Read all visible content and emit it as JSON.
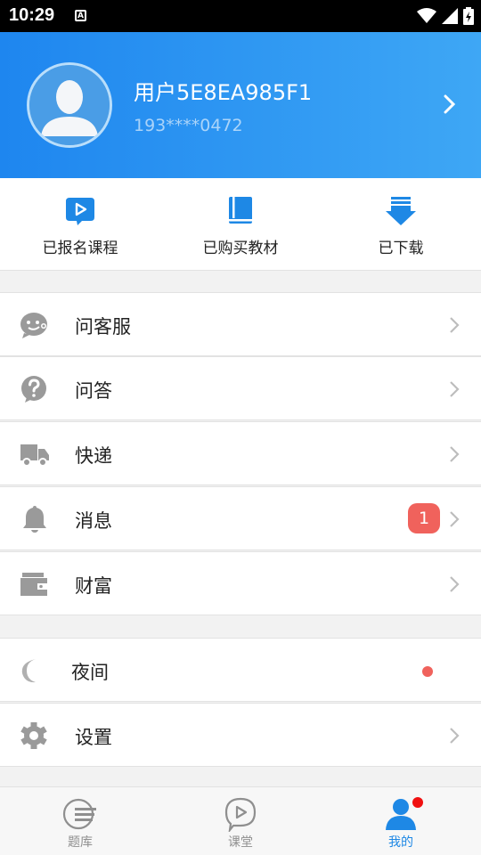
{
  "status_bar": {
    "time": "10:29",
    "a_badge": "A"
  },
  "profile": {
    "username": "用户5E8EA985F1",
    "phone": "193****0472"
  },
  "shortcuts": [
    {
      "label": "已报名课程",
      "icon": "play-bubble-icon"
    },
    {
      "label": "已购买教材",
      "icon": "book-icon"
    },
    {
      "label": "已下载",
      "icon": "download-icon"
    }
  ],
  "menu": [
    {
      "label": "问客服",
      "icon": "customer-service-icon"
    },
    {
      "label": "问答",
      "icon": "question-icon"
    },
    {
      "label": "快递",
      "icon": "truck-icon"
    },
    {
      "label": "消息",
      "icon": "bell-icon",
      "badge": "1"
    },
    {
      "label": "财富",
      "icon": "wallet-icon"
    }
  ],
  "menu2": [
    {
      "label": "夜间",
      "icon": "moon-icon"
    },
    {
      "label": "设置",
      "icon": "gear-icon"
    }
  ],
  "tabs": [
    {
      "label": "题库",
      "icon": "question-bank-icon"
    },
    {
      "label": "课堂",
      "icon": "classroom-icon"
    },
    {
      "label": "我的",
      "icon": "profile-icon",
      "active": true
    }
  ],
  "colors": {
    "brand_blue": "#1e86ef",
    "badge_red": "#f0625c",
    "icon_gray": "#9a9a9a"
  }
}
